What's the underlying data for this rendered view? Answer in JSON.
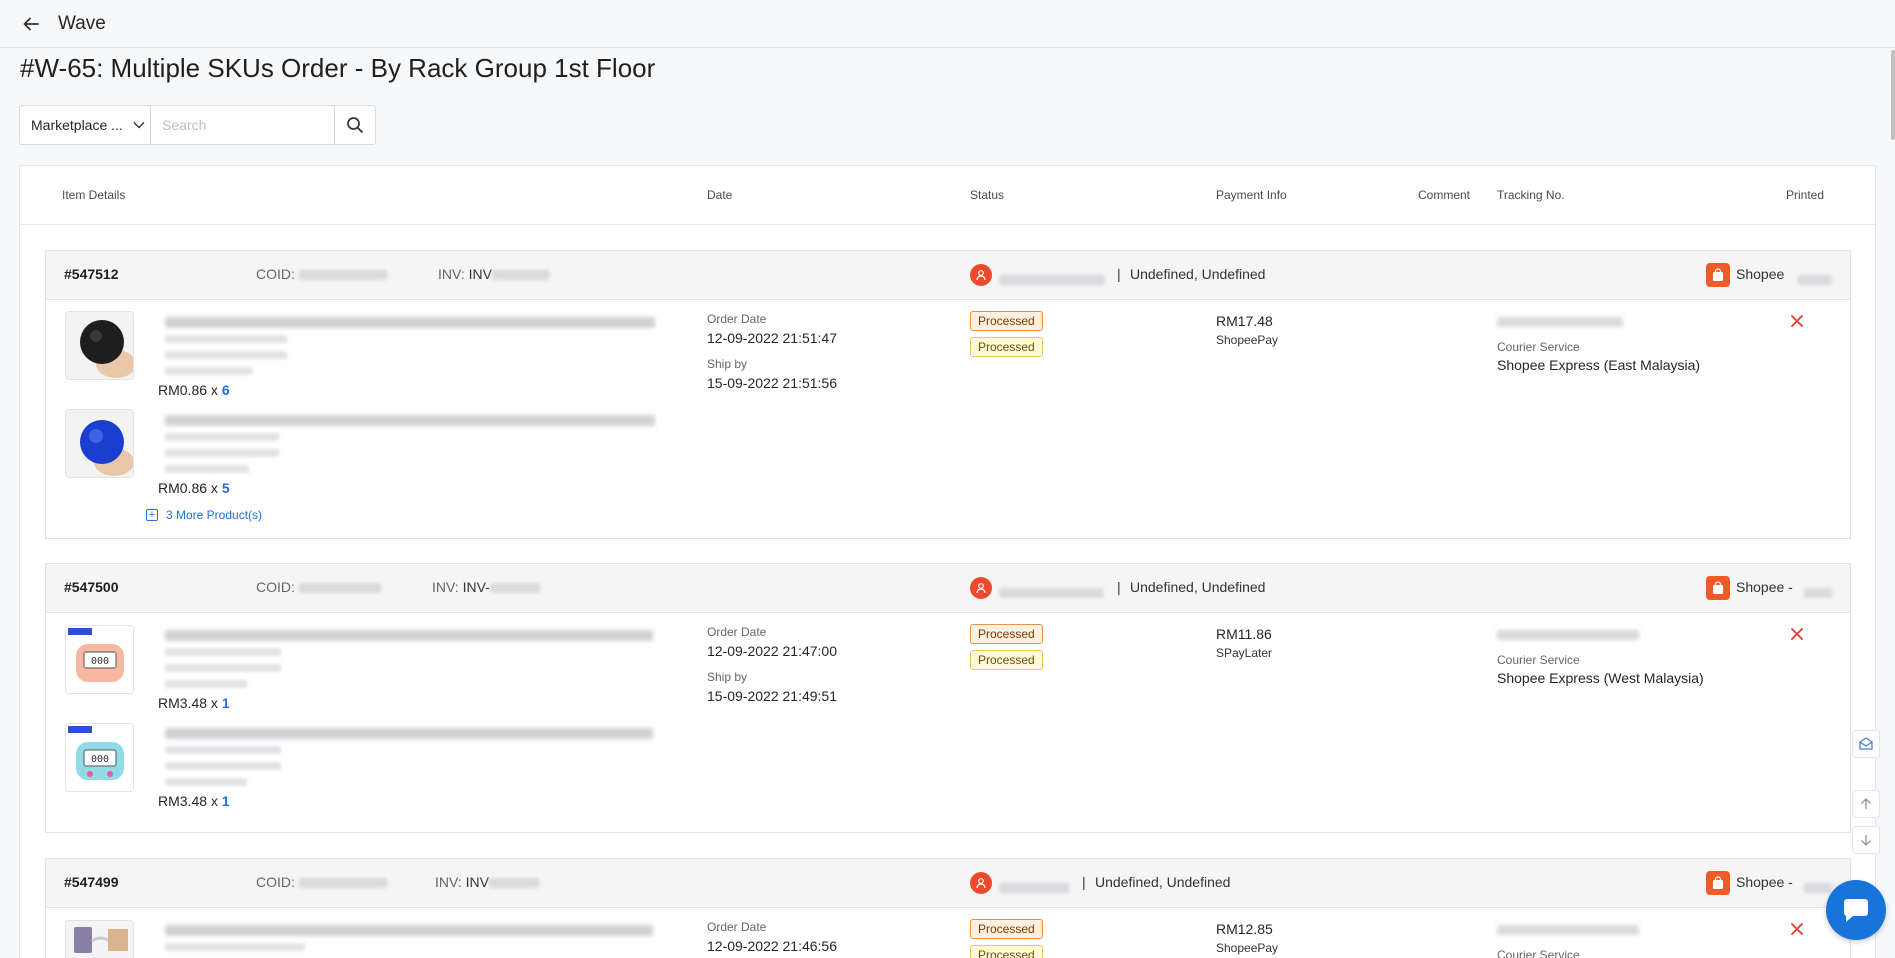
{
  "header": {
    "title": "Wave"
  },
  "page_title": "#W-65: Multiple SKUs Order - By Rack Group 1st Floor",
  "filter": {
    "select_value": "Marketplace ...",
    "search_placeholder": "Search"
  },
  "columns": [
    "Item Details",
    "Date",
    "Status",
    "Payment Info",
    "Comment",
    "Tracking No.",
    "Printed"
  ],
  "colors": {
    "link": "#1e6fd9",
    "danger": "#e53935",
    "shopee": "#f15a24"
  },
  "orders": [
    {
      "id": "#547512",
      "coid_label": "COID:",
      "inv_label": "INV:",
      "inv_prefix": "INV",
      "location": "Undefined, Undefined",
      "platform": "Shopee",
      "items": [
        {
          "price": "RM0.86 x ",
          "qty": "6"
        },
        {
          "price": "RM0.86 x ",
          "qty": "5"
        }
      ],
      "more": "3 More Product(s)",
      "order_date_label": "Order Date",
      "order_date": "12-09-2022 21:51:47",
      "ship_by_label": "Ship by",
      "ship_by": "15-09-2022 21:51:56",
      "status": [
        "Processed",
        "Processed"
      ],
      "amount": "RM17.48",
      "payment_method": "ShopeePay",
      "courier_label": "Courier Service",
      "courier": "Shopee Express (East Malaysia)"
    },
    {
      "id": "#547500",
      "coid_label": "COID:",
      "inv_label": "INV:",
      "inv_prefix": "INV-",
      "location": "Undefined, Undefined",
      "platform": "Shopee -",
      "items": [
        {
          "price": "RM3.48 x ",
          "qty": "1"
        },
        {
          "price": "RM3.48 x ",
          "qty": "1"
        }
      ],
      "order_date_label": "Order Date",
      "order_date": "12-09-2022 21:47:00",
      "ship_by_label": "Ship by",
      "ship_by": "15-09-2022 21:49:51",
      "status": [
        "Processed",
        "Processed"
      ],
      "amount": "RM11.86",
      "payment_method": "SPayLater",
      "courier_label": "Courier Service",
      "courier": "Shopee Express (West Malaysia)"
    },
    {
      "id": "#547499",
      "coid_label": "COID:",
      "inv_label": "INV:",
      "inv_prefix": "INV",
      "location": "Undefined, Undefined",
      "platform": "Shopee -",
      "order_date_label": "Order Date",
      "order_date": "12-09-2022 21:46:56",
      "status": [
        "Processed",
        "Processed"
      ],
      "amount": "RM12.85",
      "payment_method": "ShopeePay",
      "courier_label": "Courier Service"
    }
  ]
}
